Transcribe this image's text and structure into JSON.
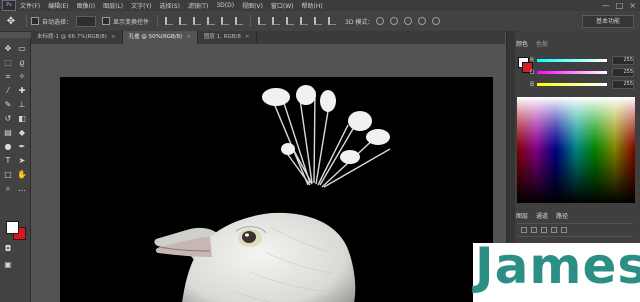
{
  "app": {
    "logo": "Ps",
    "menu": [
      "文件(F)",
      "编辑(E)",
      "图像(I)",
      "图层(L)",
      "文字(Y)",
      "选择(S)",
      "滤镜(T)",
      "3D(D)",
      "视图(V)",
      "窗口(W)",
      "帮助(H)"
    ],
    "window_controls": [
      "—",
      "□",
      "×"
    ]
  },
  "options": {
    "auto_select_label": "自动选择：",
    "show_transform_label": "显示变换控件",
    "mode3d_label": "3D 模式：",
    "workspace": "基本功能"
  },
  "tabs": [
    {
      "label": "未标题-1 @ 66.7%(RGB/8)",
      "close": "×"
    },
    {
      "label": "孔雀 @ 50%(RGB/8)",
      "close": "×",
      "active": true
    },
    {
      "label": "图层 1, RGB/8",
      "close": "×"
    }
  ],
  "panels": {
    "color_tab": "颜色",
    "swatches_tab": "色板",
    "sliders": [
      {
        "letter": "R",
        "value": "255"
      },
      {
        "letter": "G",
        "value": "255"
      },
      {
        "letter": "B",
        "value": "255"
      }
    ],
    "layers_tab": "图层",
    "channels_tab": "通道",
    "paths_tab": "路径"
  },
  "colors": {
    "foreground": "#ffffff",
    "background": "#e0141e",
    "accent": "#2b8f86"
  },
  "watermark": "James"
}
